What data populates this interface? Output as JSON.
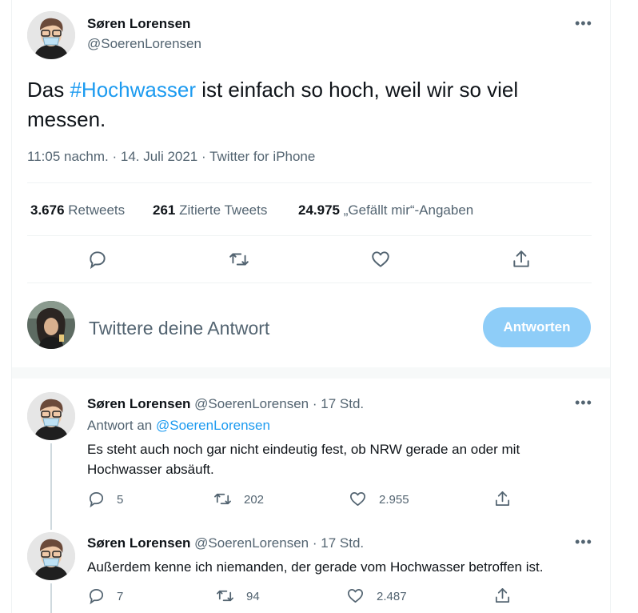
{
  "main_tweet": {
    "author_name": "Søren Lorensen",
    "author_handle": "@SoerenLorensen",
    "text_before": "Das ",
    "hashtag": "#Hochwasser",
    "text_after": " ist einfach so hoch, weil wir so viel messen.",
    "timestamp": "11:05 nachm. · 14. Juli 2021 · Twitter for iPhone",
    "stats": {
      "retweets_count": "3.676",
      "retweets_label": "Retweets",
      "quotes_count": "261",
      "quotes_label": "Zitierte Tweets",
      "likes_count": "24.975",
      "likes_label": "„Gefällt mir“-Angaben"
    }
  },
  "compose": {
    "placeholder": "Twittere deine Antwort",
    "submit_label": "Antworten"
  },
  "replies": [
    {
      "author_name": "Søren Lorensen",
      "author_handle": "@SoerenLorensen",
      "time": "· 17 Std.",
      "reply_to_label": "Antwort an",
      "reply_to_handle": "@SoerenLorensen",
      "text": "Es steht auch noch gar nicht eindeutig fest, ob NRW gerade an oder mit Hochwasser absäuft.",
      "reply_count": "5",
      "retweet_count": "202",
      "like_count": "2.955"
    },
    {
      "author_name": "Søren Lorensen",
      "author_handle": "@SoerenLorensen",
      "time": "· 17 Std.",
      "text": "Außerdem kenne ich niemanden, der gerade vom Hochwasser betroffen ist.",
      "reply_count": "7",
      "retweet_count": "94",
      "like_count": "2.487"
    }
  ],
  "icons": {
    "more": "more-icon",
    "reply": "reply-icon",
    "retweet": "retweet-icon",
    "like": "heart-icon",
    "share": "share-icon"
  },
  "colors": {
    "accent": "#1d9bf0",
    "button_disabled": "#8ecdf8",
    "muted": "#536471",
    "divider": "#eff3f4",
    "separator_band": "#f7f9f9"
  }
}
